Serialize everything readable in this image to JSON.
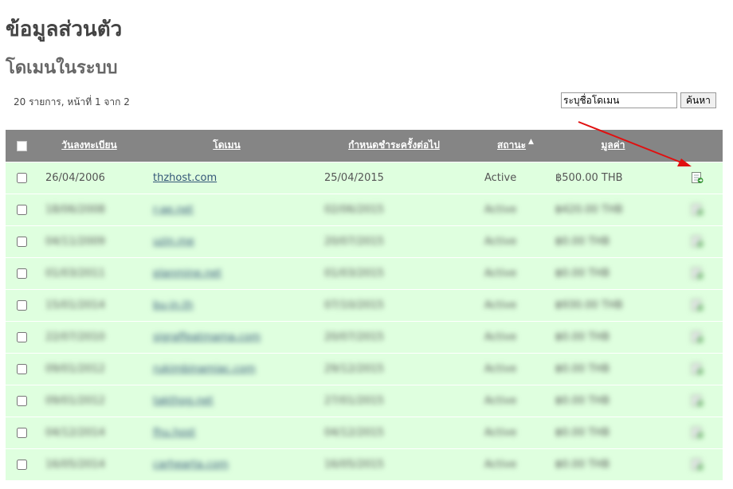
{
  "page": {
    "title": "ข้อมูลส่วนตัว",
    "section_title": "โดเมนในระบบ",
    "result_info": "20 รายการ, หน้าที่ 1 จาก 2"
  },
  "search": {
    "value": "ระบุชื่อโดเมน",
    "button_label": "ค้นหา"
  },
  "table": {
    "headers": {
      "reg_date": "วันลงทะเบียน",
      "domain": "โดเมน",
      "next_due": "กำหนดชำระครั้งต่อไป",
      "status": "สถานะ",
      "price": "มูลค่า"
    },
    "sorted_column": "status",
    "rows": [
      {
        "reg_date": "26/04/2006",
        "domain": "thzhost.com",
        "next_due": "25/04/2015",
        "status": "Active",
        "price": "฿500.00 THB"
      },
      {
        "reg_date": "18/06/2008",
        "domain": "r-ae.net",
        "next_due": "02/06/2015",
        "status": "Active",
        "price": "฿420.00 THB"
      },
      {
        "reg_date": "04/11/2009",
        "domain": "uzin.me",
        "next_due": "20/07/2015",
        "status": "Active",
        "price": "฿0.00 THB"
      },
      {
        "reg_date": "01/03/2011",
        "domain": "planmine.net",
        "next_due": "01/03/2015",
        "status": "Active",
        "price": "฿0.00 THB"
      },
      {
        "reg_date": "15/01/2014",
        "domain": "bu-in.th",
        "next_due": "07/10/2015",
        "status": "Active",
        "price": "฿930.00 THB"
      },
      {
        "reg_date": "22/07/2010",
        "domain": "sigraffeatmama.com",
        "next_due": "20/07/2015",
        "status": "Active",
        "price": "฿0.00 THB"
      },
      {
        "reg_date": "09/01/2012",
        "domain": "rukimbinamiac.com",
        "next_due": "29/12/2015",
        "status": "Active",
        "price": "฿0.00 THB"
      },
      {
        "reg_date": "09/01/2012",
        "domain": "takthog.net",
        "next_due": "27/01/2015",
        "status": "Active",
        "price": "฿0.00 THB"
      },
      {
        "reg_date": "04/12/2014",
        "domain": "fhu.host",
        "next_due": "04/12/2015",
        "status": "Active",
        "price": "฿0.00 THB"
      },
      {
        "reg_date": "16/05/2014",
        "domain": "carhearta.com",
        "next_due": "16/05/2015",
        "status": "Active",
        "price": "฿0.00 THB"
      }
    ]
  },
  "colors": {
    "header_bg": "#858585",
    "row_bg": "#dfffdf",
    "annotation_arrow": "#e01010"
  },
  "icons": {
    "row_action": "view-details-icon",
    "sort": "sort-up-icon"
  }
}
